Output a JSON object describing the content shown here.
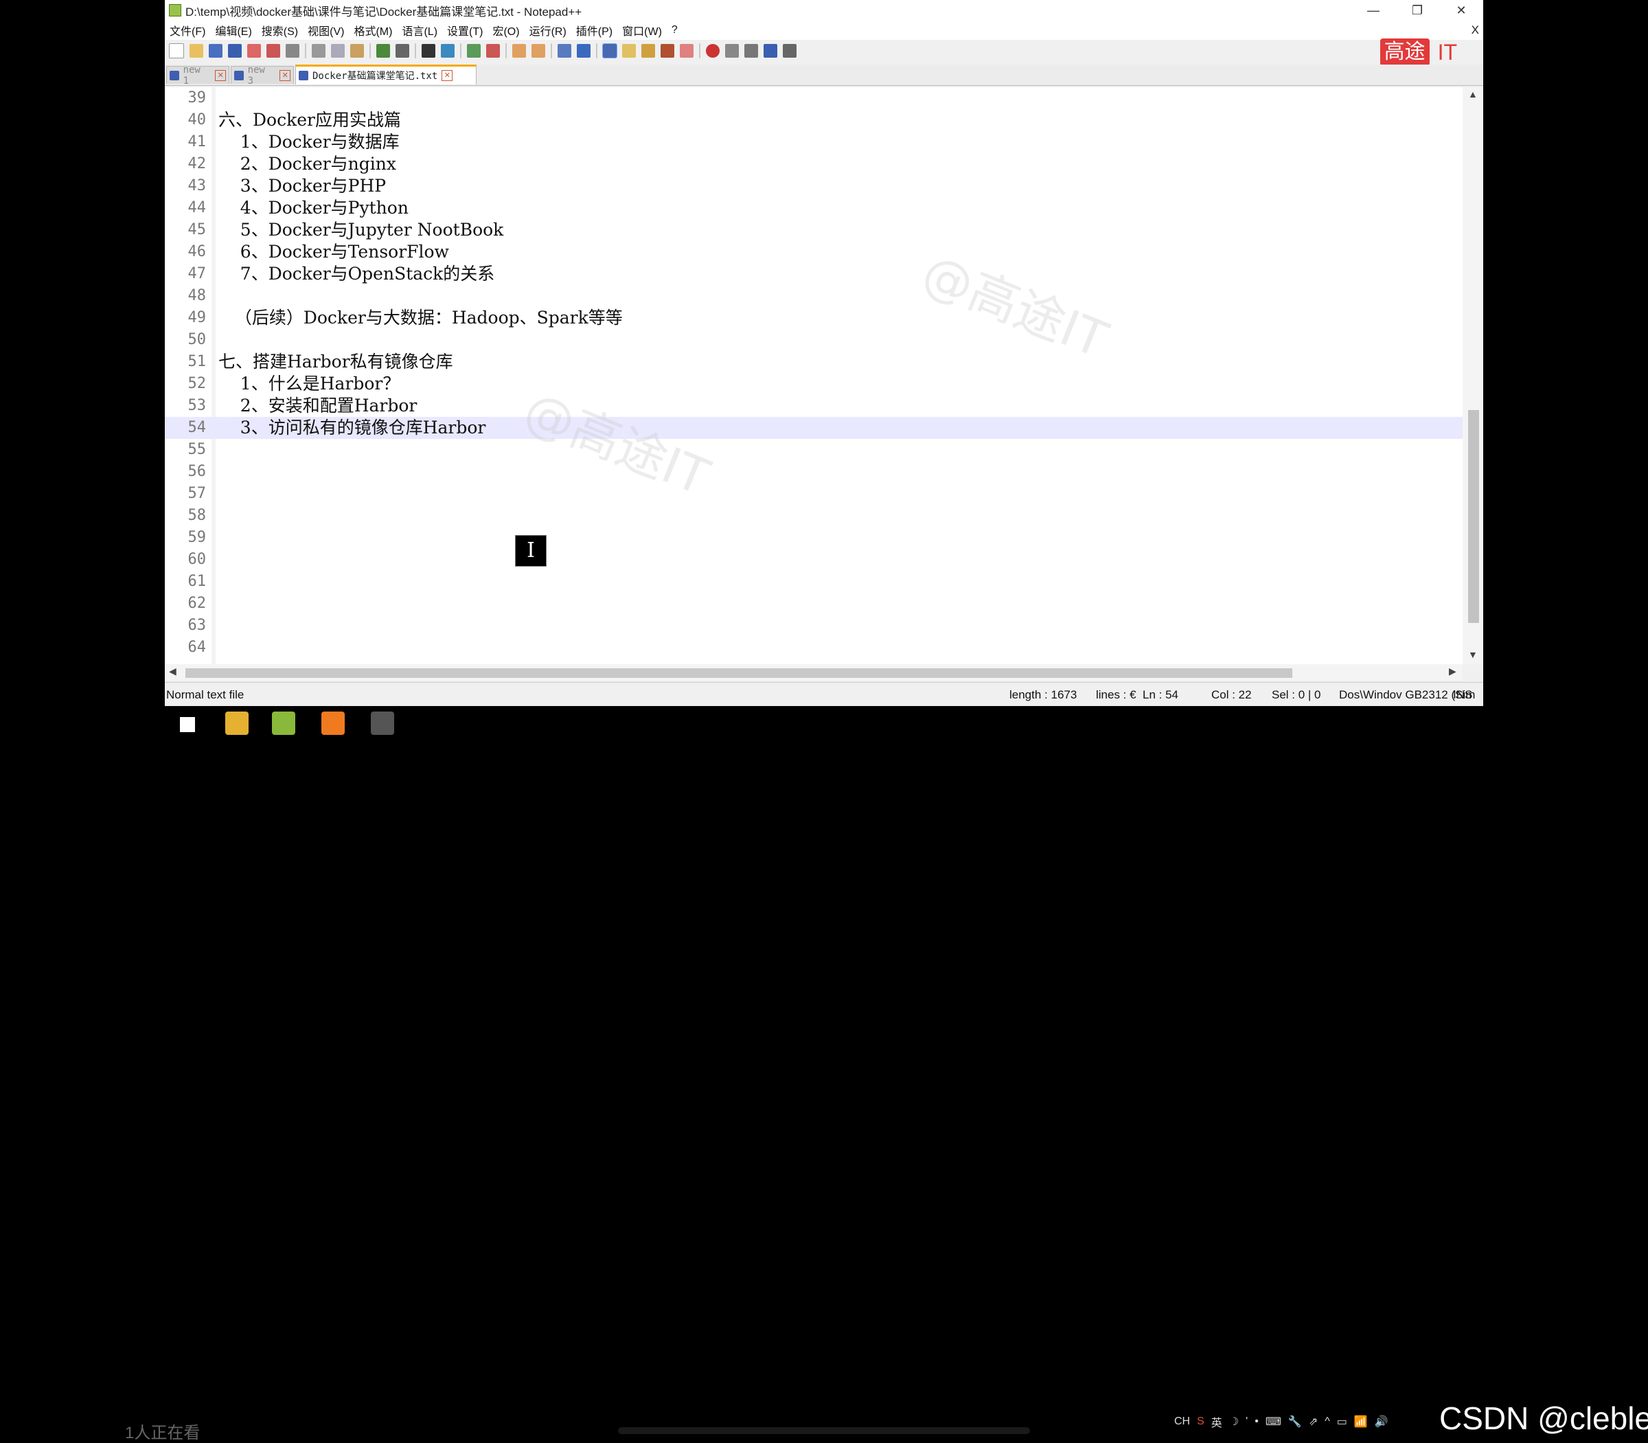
{
  "window": {
    "title": "D:\\temp\\视频\\docker基础\\课件与笔记\\Docker基础篇课堂笔记.txt - Notepad++",
    "buttons": {
      "minimize": "—",
      "restore": "❐",
      "close": "✕"
    }
  },
  "menu": {
    "items": [
      "文件(F)",
      "编辑(E)",
      "搜索(S)",
      "视图(V)",
      "格式(M)",
      "语言(L)",
      "设置(T)",
      "宏(O)",
      "运行(R)",
      "插件(P)",
      "窗口(W)",
      "?"
    ],
    "close_label": "X"
  },
  "brand": {
    "box_text": "高途",
    "it_text": "IT",
    "color": "#e23a3a"
  },
  "toolbar": {
    "icons": [
      "new-file-icon",
      "open-file-icon",
      "save-icon",
      "save-all-icon",
      "close-icon",
      "close-all-icon",
      "print-icon",
      "cut-icon",
      "copy-icon",
      "paste-icon",
      "undo-icon",
      "redo-icon",
      "find-icon",
      "replace-icon",
      "zoom-in-icon",
      "zoom-out-icon",
      "sync-vertical-icon",
      "sync-horizontal-icon",
      "word-wrap-icon",
      "show-all-chars-icon",
      "indent-guide-icon",
      "doc-map-icon",
      "function-list-icon",
      "folder-workspace-icon",
      "monitoring-icon",
      "record-macro-icon",
      "stop-macro-icon",
      "play-macro-icon",
      "run-macro-multiple-icon",
      "save-macro-icon"
    ]
  },
  "tabs": [
    {
      "label": "new 1",
      "active": false
    },
    {
      "label": "new 3",
      "active": false
    },
    {
      "label": "Docker基础篇课堂笔记.txt",
      "active": true
    }
  ],
  "editor": {
    "lines": [
      {
        "num": "39",
        "text": ""
      },
      {
        "num": "40",
        "text": "六、Docker应用实战篇"
      },
      {
        "num": "41",
        "text": "    1、Docker与数据库"
      },
      {
        "num": "42",
        "text": "    2、Docker与nginx"
      },
      {
        "num": "43",
        "text": "    3、Docker与PHP"
      },
      {
        "num": "44",
        "text": "    4、Docker与Python"
      },
      {
        "num": "45",
        "text": "    5、Docker与Jupyter NootBook"
      },
      {
        "num": "46",
        "text": "    6、Docker与TensorFlow"
      },
      {
        "num": "47",
        "text": "    7、Docker与OpenStack的关系"
      },
      {
        "num": "48",
        "text": ""
      },
      {
        "num": "49",
        "text": "   （后续）Docker与大数据：Hadoop、Spark等等"
      },
      {
        "num": "50",
        "text": ""
      },
      {
        "num": "51",
        "text": "七、搭建Harbor私有镜像仓库"
      },
      {
        "num": "52",
        "text": "    1、什么是Harbor？"
      },
      {
        "num": "53",
        "text": "    2、安装和配置Harbor"
      },
      {
        "num": "54",
        "text": "    3、访问私有的镜像仓库Harbor",
        "current": true
      },
      {
        "num": "55",
        "text": ""
      },
      {
        "num": "56",
        "text": ""
      },
      {
        "num": "57",
        "text": ""
      },
      {
        "num": "58",
        "text": ""
      },
      {
        "num": "59",
        "text": ""
      },
      {
        "num": "60",
        "text": ""
      },
      {
        "num": "61",
        "text": ""
      },
      {
        "num": "62",
        "text": ""
      },
      {
        "num": "63",
        "text": ""
      },
      {
        "num": "64",
        "text": ""
      }
    ],
    "cursor_glyph": "I",
    "watermark": "@高途IT"
  },
  "status": {
    "file_type": "Normal text file",
    "length": "length : 1673",
    "lines": "lines : €",
    "ln": "Ln : 54",
    "col": "Col : 22",
    "sel": "Sel : 0 | 0",
    "eol_enc": "Dos\\Windov GB2312 (Sim",
    "ins": "INS"
  },
  "taskbar": {
    "overlay_text": "1人正在看",
    "tray": [
      "CH",
      "S",
      "英",
      "☽",
      "'",
      "•",
      "⌨",
      "🔧",
      "⇗",
      "^",
      "▭",
      "📶",
      "🔊"
    ],
    "csdn": "CSDN @cleble"
  }
}
